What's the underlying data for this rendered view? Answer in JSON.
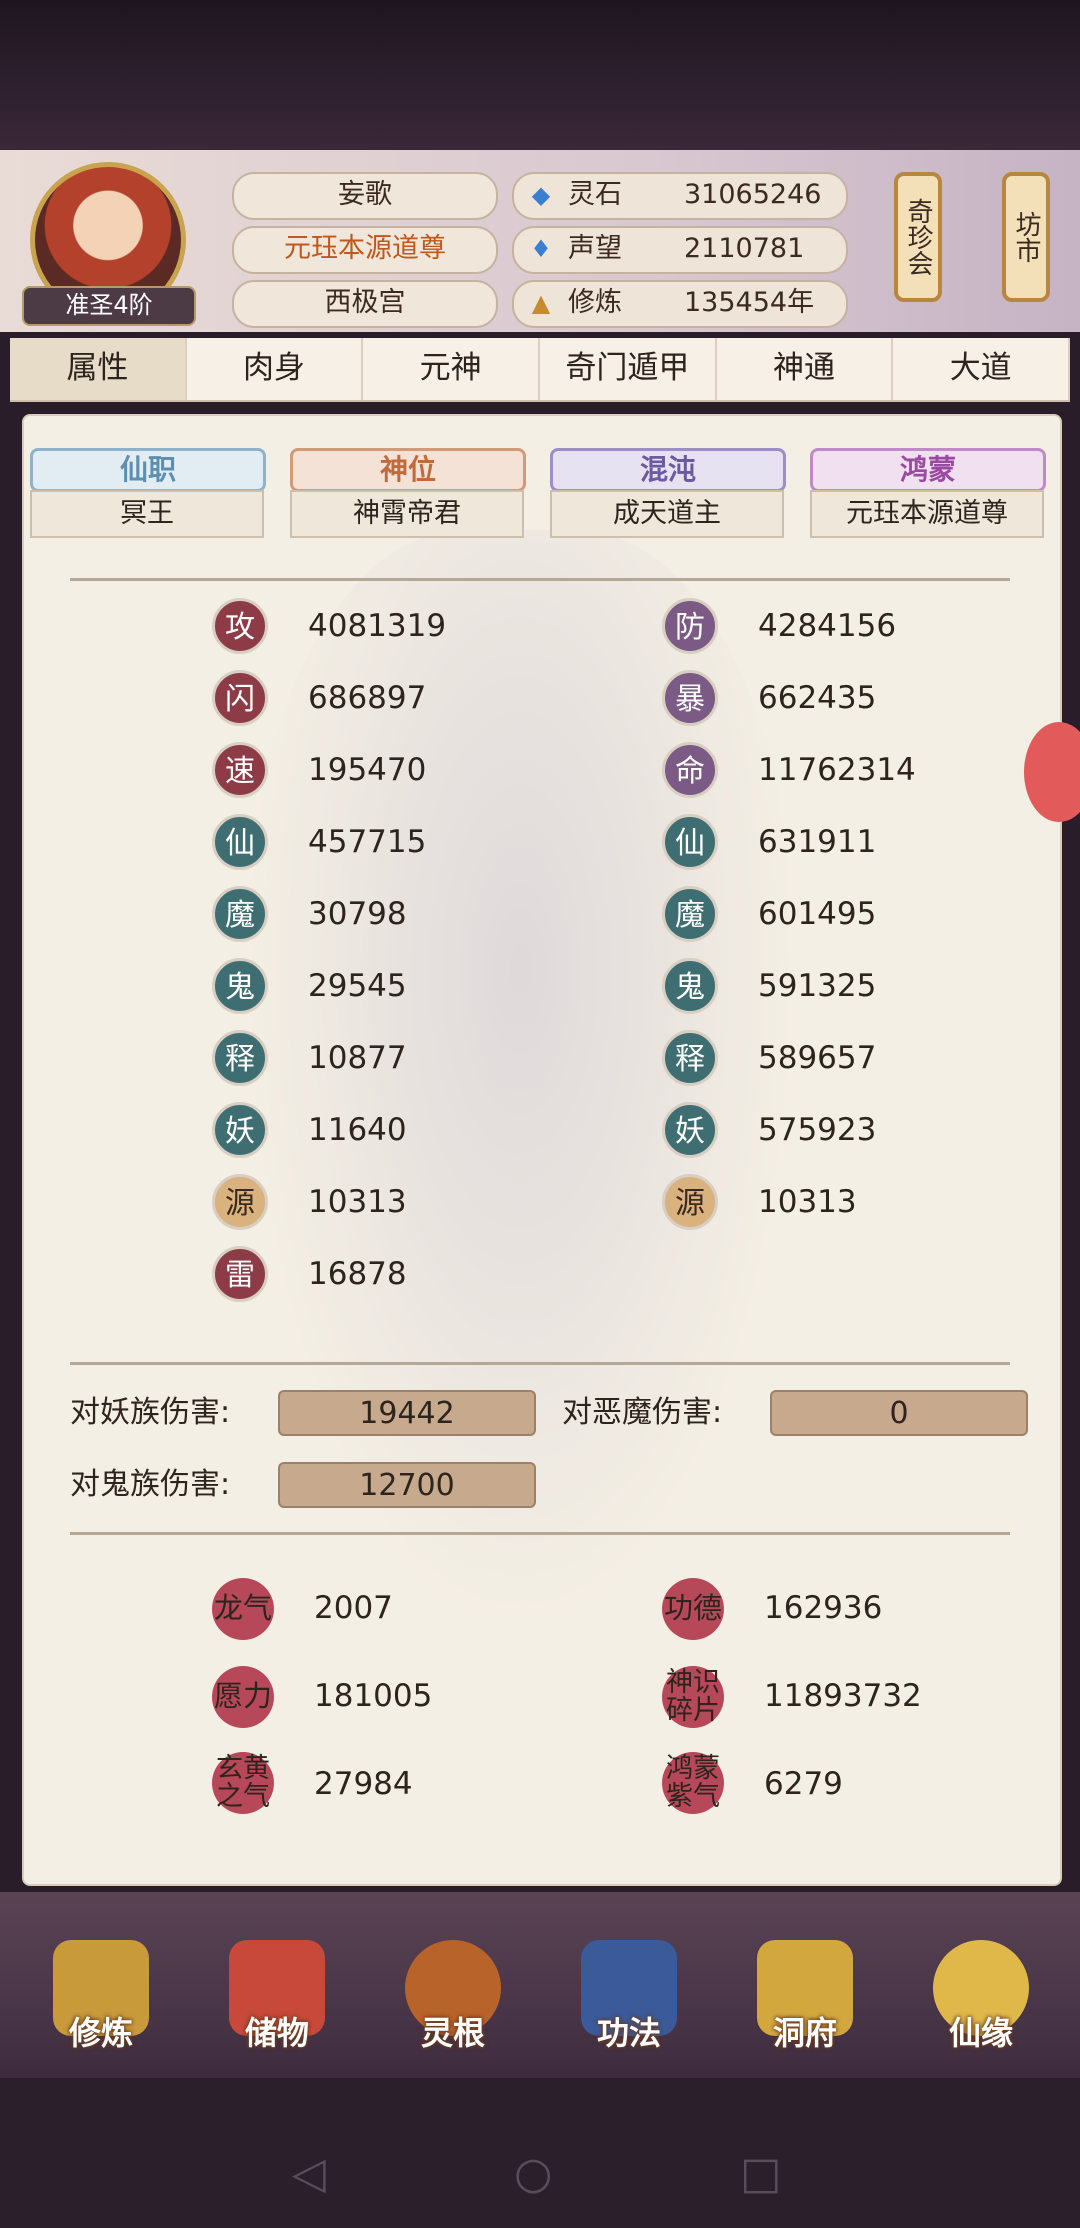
{
  "header": {
    "rank": "准圣4阶",
    "name": "妄歌",
    "title": "元珏本源道尊",
    "sect": "西极宫",
    "resources": [
      {
        "icon": "spirit-stone-icon",
        "label": "灵石",
        "value": "31065246"
      },
      {
        "icon": "reputation-icon",
        "label": "声望",
        "value": "2110781"
      },
      {
        "icon": "cultivation-icon",
        "label": "修炼",
        "value": "135454年"
      }
    ],
    "scrolls": [
      {
        "label": "奇珍会"
      },
      {
        "label": "坊市"
      }
    ]
  },
  "tabs": [
    "属性",
    "肉身",
    "元神",
    "奇门遁甲",
    "神通",
    "大道"
  ],
  "ranks": [
    {
      "title": "仙职",
      "value": "冥王",
      "color": "#5c8fb0"
    },
    {
      "title": "神位",
      "value": "神霄帝君",
      "color": "#c06a3e"
    },
    {
      "title": "混沌",
      "value": "成天道主",
      "color": "#6a5aa0"
    },
    {
      "title": "鸿蒙",
      "value": "元珏本源道尊",
      "color": "#9a4aa0"
    }
  ],
  "stats_left": [
    {
      "glyph": "攻",
      "value": "4081319"
    },
    {
      "glyph": "闪",
      "value": "686897"
    },
    {
      "glyph": "速",
      "value": "195470"
    },
    {
      "glyph": "仙",
      "value": "457715"
    },
    {
      "glyph": "魔",
      "value": "30798"
    },
    {
      "glyph": "鬼",
      "value": "29545"
    },
    {
      "glyph": "释",
      "value": "10877"
    },
    {
      "glyph": "妖",
      "value": "11640"
    },
    {
      "glyph": "源",
      "value": "10313"
    },
    {
      "glyph": "雷",
      "value": "16878"
    }
  ],
  "stats_right": [
    {
      "glyph": "防",
      "value": "4284156"
    },
    {
      "glyph": "暴",
      "value": "662435"
    },
    {
      "glyph": "命",
      "value": "11762314"
    },
    {
      "glyph": "仙",
      "value": "631911"
    },
    {
      "glyph": "魔",
      "value": "601495"
    },
    {
      "glyph": "鬼",
      "value": "591325"
    },
    {
      "glyph": "释",
      "value": "589657"
    },
    {
      "glyph": "妖",
      "value": "575923"
    },
    {
      "glyph": "源",
      "value": "10313"
    }
  ],
  "damage": [
    {
      "label": "对妖族伤害:",
      "value": "19442"
    },
    {
      "label": "对恶魔伤害:",
      "value": "0"
    },
    {
      "label": "对鬼族伤害:",
      "value": "12700"
    }
  ],
  "extras": [
    {
      "label": "龙气",
      "value": "2007"
    },
    {
      "label": "功德",
      "value": "162936"
    },
    {
      "label": "愿力",
      "value": "181005"
    },
    {
      "label": "神识碎片",
      "value": "11893732"
    },
    {
      "label": "玄黄之气",
      "value": "27984"
    },
    {
      "label": "鸿蒙紫气",
      "value": "6279"
    }
  ],
  "bottom_nav": [
    "修炼",
    "储物",
    "灵根",
    "功法",
    "洞府",
    "仙缘"
  ]
}
